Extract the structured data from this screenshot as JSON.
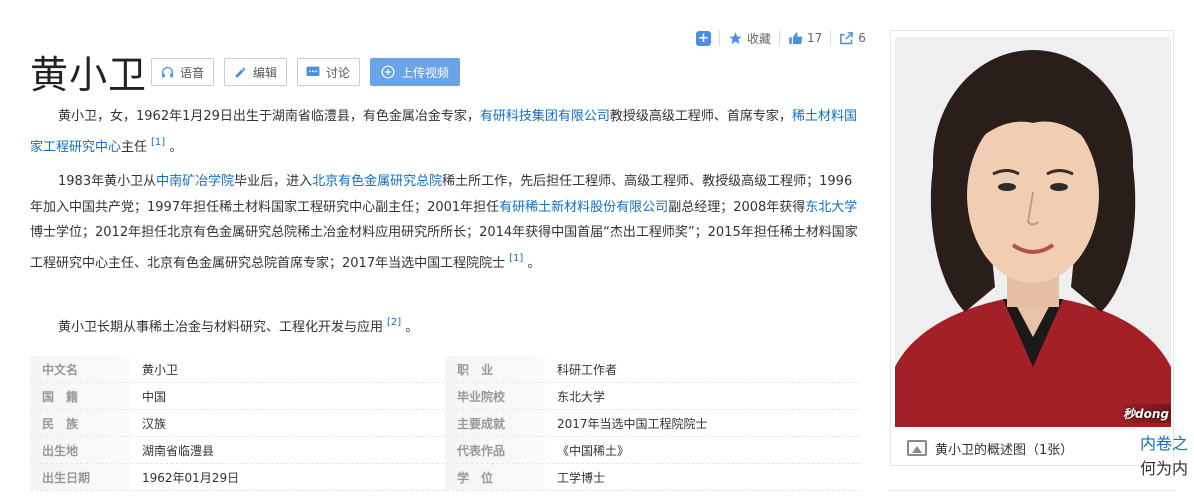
{
  "actions": {
    "collect_label": "收藏",
    "likes": "17",
    "shares": "6"
  },
  "title": "黄小卫",
  "buttons": [
    {
      "label": "语音"
    },
    {
      "label": "编辑"
    },
    {
      "label": "讨论"
    },
    {
      "label": "上传视频"
    }
  ],
  "para1": {
    "t1": "黄小卫，女，1962年1月29日出生于湖南省临澧县，有色金属冶金专家，",
    "l1": "有研科技集团有限公司",
    "t2": "教授级高级工程师、首席专家，",
    "l2": "稀土材料国家工程研究中心",
    "t3": "主任",
    "ref": "[1]",
    "t4": " 。"
  },
  "para2": {
    "t1": "1983年黄小卫从",
    "l1": "中南矿冶学院",
    "t2": "毕业后，进入",
    "l2": "北京有色金属研究总院",
    "t3": "稀土所工作，先后担任工程师、高级工程师、教授级高级工程师；1996年加入中国共产党；1997年担任稀土材料国家工程研究中心副主任；2001年担任",
    "l3": "有研稀土新材料股份有限公司",
    "t4": "副总经理；2008年获得",
    "l4": "东北大学",
    "t5": "博士学位；2012年担任北京有色金属研究总院稀土冶金材料应用研究所所长；2014年获得中国首届“杰出工程师奖”；2015年担任稀土材料国家工程研究中心主任、北京有色金属研究总院首席专家；2017年当选中国工程院院士",
    "ref": "[1]",
    "t6": " 。"
  },
  "para3": {
    "t1": "黄小卫长期从事稀土冶金与材料研究、工程化开发与应用",
    "ref": "[2]",
    "t2": " 。"
  },
  "info": [
    {
      "k": "中文名",
      "v": "黄小卫",
      "k2": "职　业",
      "v2": "科研工作者"
    },
    {
      "k": "国　籍",
      "v": "中国",
      "k2": "毕业院校",
      "v2": "东北大学"
    },
    {
      "k": "民　族",
      "v": "汉族",
      "k2": "主要成就",
      "v2": "2017年当选中国工程院院士"
    },
    {
      "k": "出生地",
      "v": "湖南省临澧县",
      "k2": "代表作品",
      "v2": "《中国稀土》"
    },
    {
      "k": "出生日期",
      "v": "1962年01月29日",
      "k2": "学　位",
      "v2": "工学博士"
    }
  ],
  "panel": {
    "caption": "黄小卫的概述图（1张）",
    "watermark": "秒dong"
  },
  "side": {
    "link": "内卷之",
    "text": "何为内"
  },
  "colors": {
    "link": "#136ec2",
    "accent": "#4a90e2",
    "primary_button": "#6aa3e8"
  }
}
